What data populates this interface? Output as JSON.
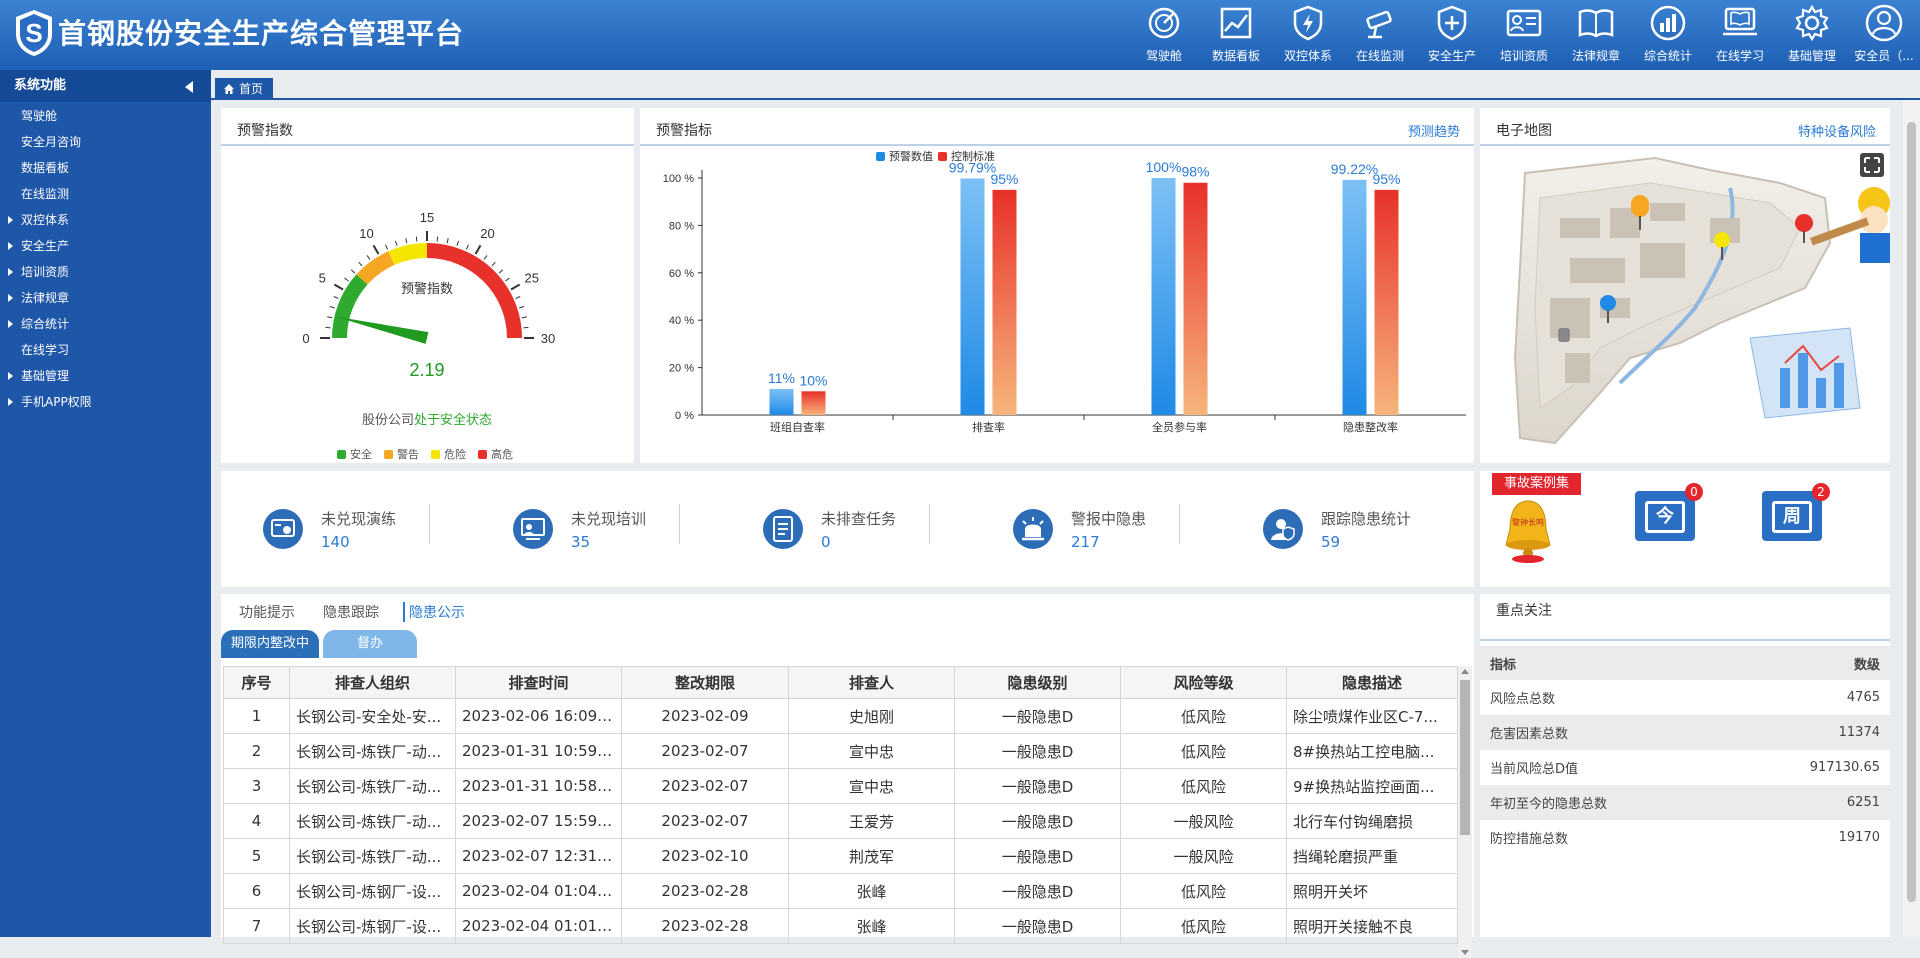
{
  "app": {
    "title": "首钢股份安全生产综合管理平台"
  },
  "nav": [
    {
      "label": "驾驶舱",
      "icon": "gauge-icon"
    },
    {
      "label": "数据看板",
      "icon": "trend-chart-icon"
    },
    {
      "label": "双控体系",
      "icon": "shield-bolt-icon"
    },
    {
      "label": "在线监测",
      "icon": "camera-icon"
    },
    {
      "label": "安全生产",
      "icon": "shield-plus-icon"
    },
    {
      "label": "培训资质",
      "icon": "id-card-icon"
    },
    {
      "label": "法律规章",
      "icon": "book-icon"
    },
    {
      "label": "综合统计",
      "icon": "bar-chart-icon"
    },
    {
      "label": "在线学习",
      "icon": "laptop-book-icon"
    },
    {
      "label": "基础管理",
      "icon": "gear-icon"
    },
    {
      "label": "安全员（...",
      "icon": "user-icon"
    }
  ],
  "sidebar": {
    "title": "系统功能",
    "items": [
      {
        "label": "驾驶舱",
        "expandable": false
      },
      {
        "label": "安全月咨询",
        "expandable": false
      },
      {
        "label": "数据看板",
        "expandable": false
      },
      {
        "label": "在线监测",
        "expandable": false
      },
      {
        "label": "双控体系",
        "expandable": true
      },
      {
        "label": "安全生产",
        "expandable": true
      },
      {
        "label": "培训资质",
        "expandable": true
      },
      {
        "label": "法律规章",
        "expandable": true
      },
      {
        "label": "综合统计",
        "expandable": true
      },
      {
        "label": "在线学习",
        "expandable": false
      },
      {
        "label": "基础管理",
        "expandable": true
      },
      {
        "label": "手机APP权限",
        "expandable": true
      }
    ]
  },
  "tabs": {
    "home": "首页"
  },
  "gauge_panel": {
    "title": "预警指数",
    "center_label": "预警指数",
    "value": 2.19,
    "value_text": "2.19",
    "min": 0,
    "max": 30,
    "ticks": [
      "0",
      "5",
      "10",
      "15",
      "20",
      "25",
      "30"
    ],
    "status_prefix": "股份公司",
    "status_text": "处于安全状态",
    "legend": [
      {
        "label": "安全",
        "color": "#2eaa2e"
      },
      {
        "label": "警告",
        "color": "#f5a623"
      },
      {
        "label": "危险",
        "color": "#f5e600"
      },
      {
        "label": "高危",
        "color": "#e8312a"
      }
    ]
  },
  "indicator_panel": {
    "title": "预警指标",
    "link": "预测趋势"
  },
  "chart_data": {
    "type": "bar",
    "categories": [
      "班组自查率",
      "排查率",
      "全员参与率",
      "隐患整改率"
    ],
    "series": [
      {
        "name": "预警数值",
        "values": [
          11,
          99.79,
          100,
          99.22
        ],
        "labels": [
          "11%",
          "99.79%",
          "100%",
          "99.22%"
        ],
        "color": "#1f8ae6"
      },
      {
        "name": "控制标准",
        "values": [
          10,
          95,
          98,
          95
        ],
        "labels": [
          "10%",
          "95%",
          "98%",
          "95%"
        ],
        "color": "#e8312a"
      }
    ],
    "yticks": [
      "0 %",
      "20 %",
      "40 %",
      "60 %",
      "80 %",
      "100 %"
    ],
    "ylim": [
      0,
      100
    ],
    "legend": "top-center",
    "grid": false
  },
  "map_panel": {
    "title": "电子地图",
    "link": "特种设备风险"
  },
  "stats": [
    {
      "label": "未兑现演练",
      "value": "140",
      "icon": "drill-icon"
    },
    {
      "label": "未兑现培训",
      "value": "35",
      "icon": "training-icon"
    },
    {
      "label": "未排查任务",
      "value": "0",
      "icon": "task-icon"
    },
    {
      "label": "警报中隐患",
      "value": "217",
      "icon": "alarm-icon"
    },
    {
      "label": "跟踪隐患统计",
      "value": "59",
      "icon": "tracking-icon"
    }
  ],
  "cases": {
    "ribbon": "事故案例集",
    "bell_text": "警钟长鸣",
    "today_label": "今",
    "today_count": "0",
    "week_label": "周",
    "week_count": "2"
  },
  "hazard_panel": {
    "tabs": [
      "功能提示",
      "隐患跟踪",
      "隐患公示"
    ],
    "active_tab": 2,
    "buttons": [
      "期限内整改中",
      "督办"
    ],
    "columns": [
      "序号",
      "排查人组织",
      "排查时间",
      "整改期限",
      "排查人",
      "隐患级别",
      "风险等级",
      "隐患描述"
    ],
    "rows": [
      [
        "1",
        "长钢公司-安全处-安...",
        "2023-02-06 16:09:...",
        "2023-02-09",
        "史旭刚",
        "一般隐患D",
        "低风险",
        "除尘喷煤作业区C-7..."
      ],
      [
        "2",
        "长钢公司-炼铁厂-动...",
        "2023-01-31 10:59:...",
        "2023-02-07",
        "宣中忠",
        "一般隐患D",
        "低风险",
        "8#换热站工控电脑..."
      ],
      [
        "3",
        "长钢公司-炼铁厂-动...",
        "2023-01-31 10:58:...",
        "2023-02-07",
        "宣中忠",
        "一般隐患D",
        "低风险",
        "9#换热站监控画面..."
      ],
      [
        "4",
        "长钢公司-炼铁厂-动...",
        "2023-02-07 15:59:...",
        "2023-02-07",
        "王爱芳",
        "一般隐患D",
        "一般风险",
        "北行车付钩绳磨损"
      ],
      [
        "5",
        "长钢公司-炼铁厂-动...",
        "2023-02-07 12:31:...",
        "2023-02-10",
        "荆茂军",
        "一般隐患D",
        "一般风险",
        "挡绳轮磨损严重"
      ],
      [
        "6",
        "长钢公司-炼钢厂-设...",
        "2023-02-04 01:04:...",
        "2023-02-28",
        "张峰",
        "一般隐患D",
        "低风险",
        "照明开关坏"
      ],
      [
        "7",
        "长钢公司-炼钢厂-设...",
        "2023-02-04 01:01:...",
        "2023-02-28",
        "张峰",
        "一般隐患D",
        "低风险",
        "照明开关接触不良"
      ]
    ]
  },
  "focus_panel": {
    "title": "重点关注",
    "header": [
      "指标",
      "数级"
    ],
    "rows": [
      [
        "风险点总数",
        "4765"
      ],
      [
        "危害因素总数",
        "11374"
      ],
      [
        "当前风险总D值",
        "917130.65"
      ],
      [
        "年初至今的隐患总数",
        "6251"
      ],
      [
        "防控措施总数",
        "19170"
      ]
    ]
  }
}
